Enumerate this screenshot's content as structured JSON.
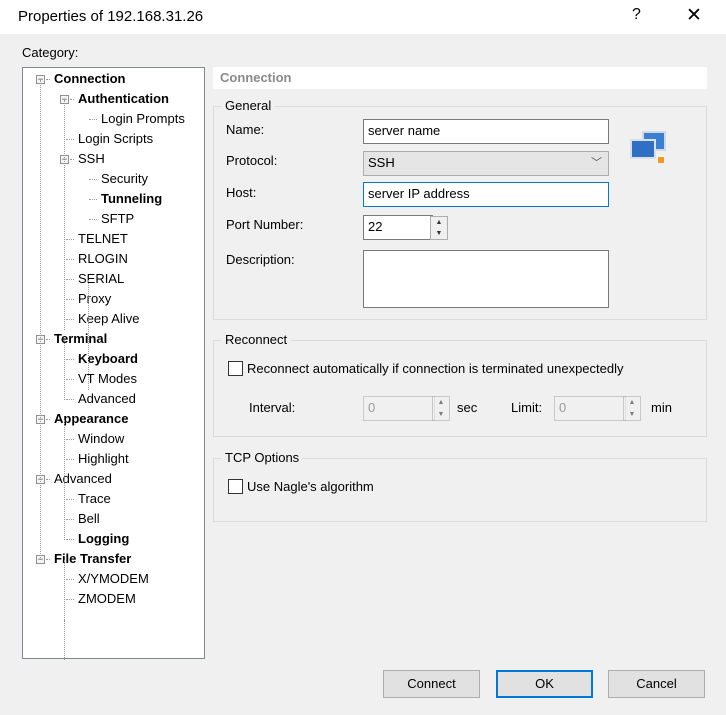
{
  "window": {
    "title": "Properties of 192.168.31.26",
    "help": "?",
    "close": "✕"
  },
  "category_label": "Category:",
  "tree": [
    {
      "label": "Connection",
      "level": 0,
      "bold": true,
      "expander": "−"
    },
    {
      "label": "Authentication",
      "level": 1,
      "bold": true,
      "expander": "−"
    },
    {
      "label": "Login Prompts",
      "level": 2,
      "bold": false
    },
    {
      "label": "Login Scripts",
      "level": 1,
      "bold": false
    },
    {
      "label": "SSH",
      "level": 1,
      "bold": false,
      "expander": "−"
    },
    {
      "label": "Security",
      "level": 2,
      "bold": false
    },
    {
      "label": "Tunneling",
      "level": 2,
      "bold": true
    },
    {
      "label": "SFTP",
      "level": 2,
      "bold": false
    },
    {
      "label": "TELNET",
      "level": 1,
      "bold": false
    },
    {
      "label": "RLOGIN",
      "level": 1,
      "bold": false
    },
    {
      "label": "SERIAL",
      "level": 1,
      "bold": false
    },
    {
      "label": "Proxy",
      "level": 1,
      "bold": false
    },
    {
      "label": "Keep Alive",
      "level": 1,
      "bold": false
    },
    {
      "label": "Terminal",
      "level": 0,
      "bold": true,
      "expander": "−"
    },
    {
      "label": "Keyboard",
      "level": 1,
      "bold": true
    },
    {
      "label": "VT Modes",
      "level": 1,
      "bold": false
    },
    {
      "label": "Advanced",
      "level": 1,
      "bold": false
    },
    {
      "label": "Appearance",
      "level": 0,
      "bold": true,
      "expander": "−"
    },
    {
      "label": "Window",
      "level": 1,
      "bold": false
    },
    {
      "label": "Highlight",
      "level": 1,
      "bold": false
    },
    {
      "label": "Advanced",
      "level": 0,
      "bold": false,
      "expander": "−"
    },
    {
      "label": "Trace",
      "level": 1,
      "bold": false
    },
    {
      "label": "Bell",
      "level": 1,
      "bold": false
    },
    {
      "label": "Logging",
      "level": 1,
      "bold": true
    },
    {
      "label": "File Transfer",
      "level": 0,
      "bold": true,
      "expander": "−"
    },
    {
      "label": "X/YMODEM",
      "level": 1,
      "bold": false
    },
    {
      "label": "ZMODEM",
      "level": 1,
      "bold": false
    }
  ],
  "panel_header": "Connection",
  "general": {
    "title": "General",
    "name_label": "Name:",
    "name_value": "server name",
    "protocol_label": "Protocol:",
    "protocol_value": "SSH",
    "host_label": "Host:",
    "host_value": "server IP address",
    "port_label": "Port Number:",
    "port_value": "22",
    "description_label": "Description:",
    "description_value": ""
  },
  "reconnect": {
    "title": "Reconnect",
    "checkbox_label": "Reconnect automatically if connection is terminated unexpectedly",
    "checked": false,
    "interval_label": "Interval:",
    "interval_value": "0",
    "sec": "sec",
    "limit_label": "Limit:",
    "limit_value": "0",
    "min": "min"
  },
  "tcp": {
    "title": "TCP Options",
    "nagle_label": "Use Nagle's algorithm",
    "checked": false
  },
  "buttons": {
    "connect": "Connect",
    "ok": "OK",
    "cancel": "Cancel"
  }
}
